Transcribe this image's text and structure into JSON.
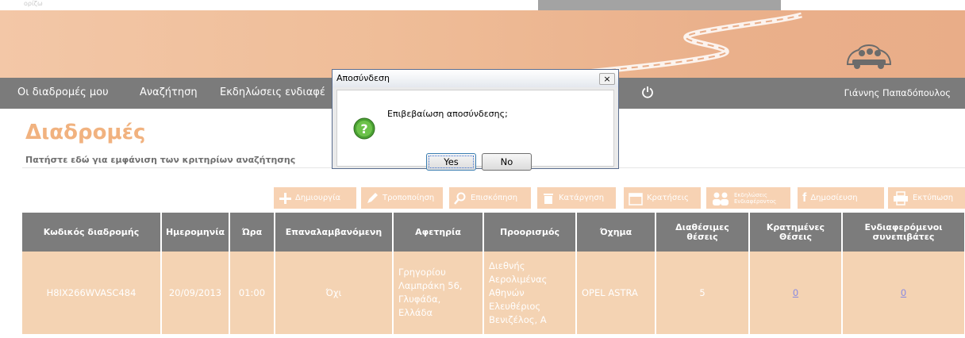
{
  "header": {
    "logo_text": "ορίζω"
  },
  "nav": {
    "items": [
      {
        "label": "Οι διαδρομές μου"
      },
      {
        "label": "Αναζήτηση"
      },
      {
        "label": "Εκδηλώσεις ενδιαφέ"
      }
    ],
    "user_name": "Γιάννης Παπαδόπουλος"
  },
  "page": {
    "title": "Διαδρομές",
    "search_hint": "Πατήστε εδώ για εμφάνιση των κριτηρίων αναζήτησης"
  },
  "toolbar": {
    "buttons": [
      {
        "label": "Δημιουργία",
        "icon": "plus-icon"
      },
      {
        "label": "Τροποποίηση",
        "icon": "pencil-icon"
      },
      {
        "label": "Επισκόπηση",
        "icon": "search-icon"
      },
      {
        "label": "Κατάργηση",
        "icon": "trash-icon"
      },
      {
        "label": "Κρατήσεις",
        "icon": "calendar-icon"
      },
      {
        "label": "Εκδηλώσεις Ενδιαφέροντος",
        "icon": "people-icon"
      },
      {
        "label": "Δημοσίευση",
        "icon": "facebook-icon"
      },
      {
        "label": "Εκτύπωση",
        "icon": "print-icon"
      }
    ]
  },
  "table": {
    "columns": [
      "Κωδικός διαδρομής",
      "Ημερομηνία",
      "Ώρα",
      "Επαναλαμβανόμενη",
      "Αφετηρία",
      "Προορισμός",
      "Όχημα",
      "Διαθέσιμες θέσεις",
      "Κρατημένες Θέσεις",
      "Ενδιαφερόμενοι συνεπιβάτες"
    ],
    "rows": [
      {
        "code": "H8IX266WVASC484",
        "date": "20/09/2013",
        "time": "01:00",
        "recurring": "Όχι",
        "origin": "Γρηγορίου Λαμπράκη 56, Γλυφάδα, Ελλάδα",
        "destination": "Διεθνής Αερολιμένας Αθηνών Ελευθέριος Βενιζέλος, Α",
        "vehicle": "OPEL ASTRA",
        "seats": "5",
        "booked": "0",
        "interested": "0"
      }
    ]
  },
  "dialog": {
    "title": "Αποσύνδεση",
    "close": "×",
    "message": "Επιβεβαίωση αποσύνδεσης;",
    "yes": "Yes",
    "no": "No",
    "icon": "question-icon"
  },
  "colors": {
    "accent": "#f1b27f",
    "nav": "#7b7b7b",
    "row": "#f4d3b3"
  }
}
